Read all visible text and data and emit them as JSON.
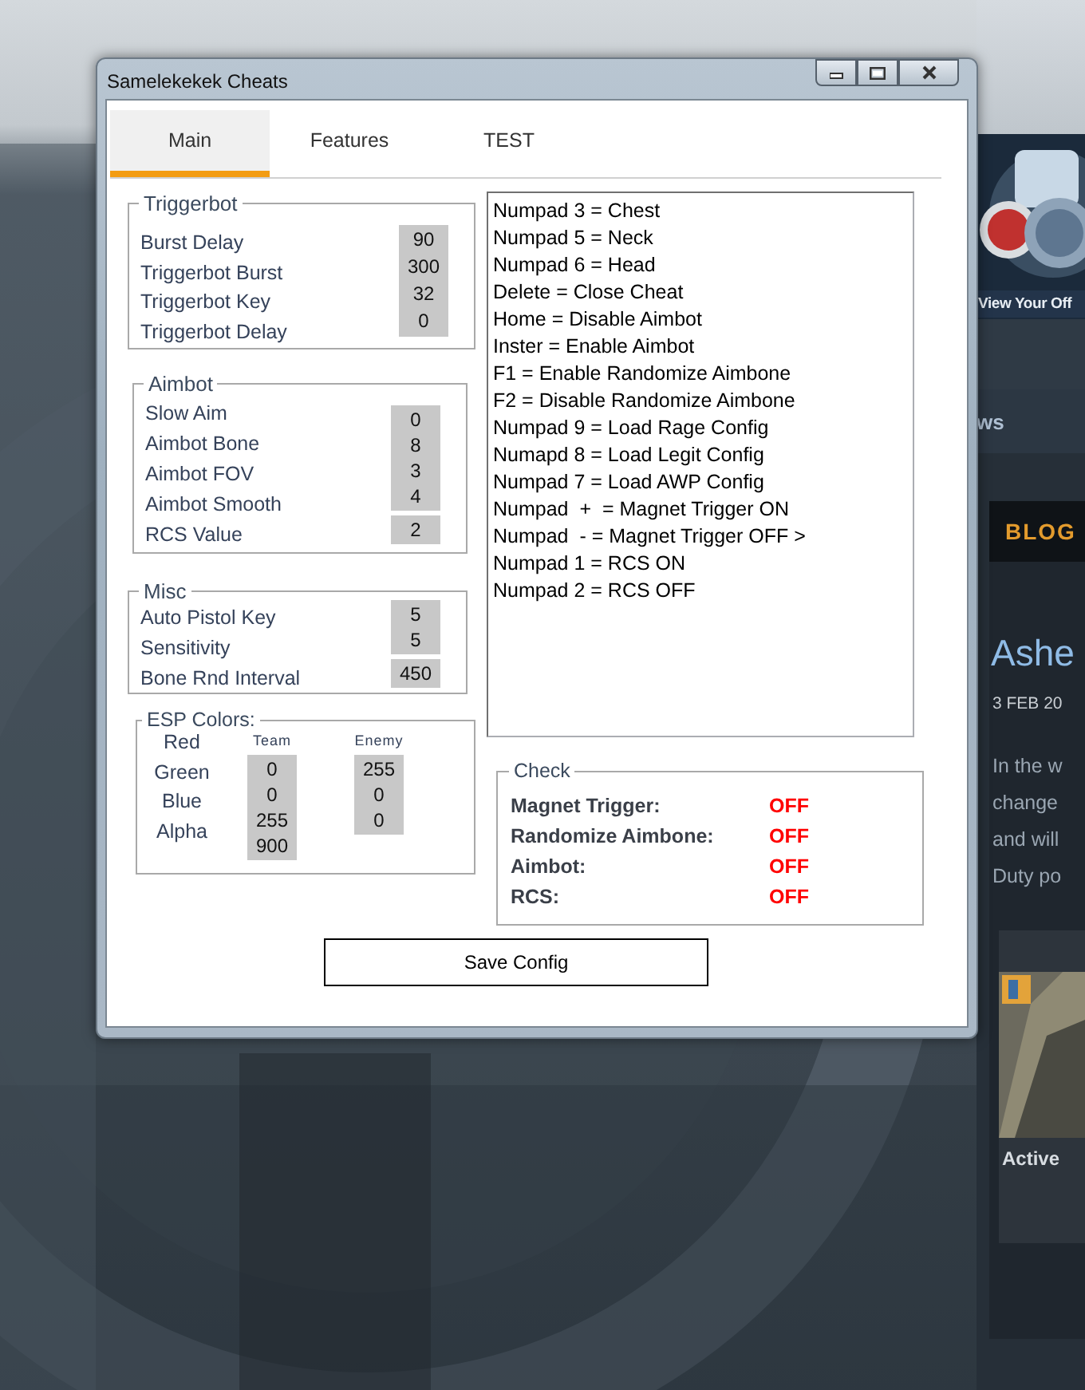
{
  "window": {
    "title": "Samelekekek Cheats"
  },
  "tabs": [
    {
      "label": "Main",
      "selected": true
    },
    {
      "label": "Features",
      "selected": false
    },
    {
      "label": "TEST",
      "selected": false
    }
  ],
  "groups": [
    {
      "title": "Triggerbot",
      "labels": [
        "Burst Delay",
        "Triggerbot Burst",
        "Triggerbot Key",
        "Triggerbot Delay"
      ],
      "value_boxes": [
        [
          "90",
          "300",
          "32",
          "0"
        ]
      ]
    },
    {
      "title": "Aimbot",
      "labels": [
        "Slow Aim",
        "Aimbot Bone",
        "Aimbot FOV",
        "Aimbot Smooth",
        "RCS Value"
      ],
      "value_boxes": [
        [
          "0",
          "8",
          "3",
          "4"
        ],
        [
          "2"
        ]
      ]
    },
    {
      "title": "Misc",
      "labels": [
        "Auto Pistol Key",
        "Sensitivity",
        "Bone Rnd Interval"
      ],
      "value_boxes": [
        [
          "5",
          "5"
        ],
        [
          "450"
        ]
      ]
    }
  ],
  "esp_colors": {
    "title": "ESP Colors:",
    "channels": [
      "Red",
      "Green",
      "Blue",
      "Alpha"
    ],
    "columns": [
      {
        "heading": "Team",
        "values": [
          "0",
          "0",
          "255",
          "900"
        ]
      },
      {
        "heading": "Enemy",
        "values": [
          "255",
          "0",
          "0"
        ]
      }
    ]
  },
  "hotkeys": [
    "Numpad 3 = Chest",
    "Numpad 5 = Neck",
    "Numpad 6 = Head",
    "Delete = Close Cheat",
    "Home = Disable Aimbot",
    "Inster = Enable Aimbot",
    "F1 = Enable Randomize Aimbone",
    "F2 = Disable Randomize Aimbone",
    "Numpad 9 = Load Rage Config",
    "Numapd 8 = Load Legit Config",
    "Numpad 7 = Load AWP Config",
    "Numpad  +  = Magnet Trigger ON",
    "Numpad  - = Magnet Trigger OFF >",
    "Numpad 1 = RCS ON",
    "Numpad 2 = RCS OFF"
  ],
  "check": {
    "title": "Check",
    "items": [
      {
        "label": "Magnet Trigger:",
        "status": "OFF",
        "on": false
      },
      {
        "label": "Randomize Aimbone:",
        "status": "OFF",
        "on": false
      },
      {
        "label": "Aimbot:",
        "status": "OFF",
        "on": false
      },
      {
        "label": "RCS:",
        "status": "OFF",
        "on": false
      }
    ]
  },
  "save_button": "Save Config",
  "background_page": {
    "banner_link": "View Your Off",
    "nav_item": "ws",
    "section": "BLOG",
    "headline": "Ashe",
    "date": "3 FEB 20",
    "excerpt_lines": [
      "In the w",
      "change",
      "and will",
      "Duty po"
    ],
    "card_title": "Active"
  }
}
